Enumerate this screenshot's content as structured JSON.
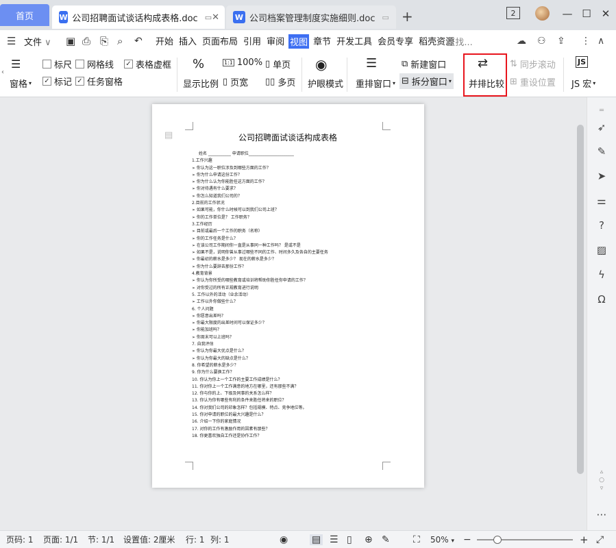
{
  "tabs": {
    "home": "首页",
    "active_doc": "公司招聘面试谈话构成表格.doc",
    "inactive_doc": "公司档案管理制度实施细则.doc",
    "new_tab": "+",
    "window_count": "2"
  },
  "menu": {
    "file": "文件",
    "search": "查找...",
    "items": [
      "开始",
      "插入",
      "页面布局",
      "引用",
      "审阅",
      "视图",
      "章节",
      "开发工具",
      "会员专享",
      "稻壳资源"
    ],
    "selected": "视图"
  },
  "ribbon": {
    "nav_pane": "窗格",
    "ruler": "标尺",
    "gridlines": "网格线",
    "table_gridlines": "表格虚框",
    "marks": "标记",
    "task_pane": "任务窗格",
    "display_ratio": "显示比例",
    "zoom_100": "100%",
    "page_width": "页宽",
    "single_page": "单页",
    "multi_page": "多页",
    "eye_mode": "护眼模式",
    "rearrange_window": "重排窗口",
    "new_window": "新建窗口",
    "split_window": "拆分窗口",
    "side_by_side": "并排比较",
    "sync_scroll": "同步滚动",
    "reset_position": "重设位置",
    "js_macro": "JS 宏"
  },
  "document": {
    "title": "公司招聘面试谈话构成表格",
    "lines": [
      "姓名 ___________          申请职位______________________",
      "1.工作兴趣",
      "➢   你认为这一职位涉及到哪些方面的工作？",
      "➢   你为什么申请这份工作？",
      "➢   你为什么认为你能胜任这方面的工作？",
      "➢   你对待遇有什么要求？",
      "➢   你怎么知道我们公司的？",
      "2.目前的工作状况",
      "➢   如果可能，你什么时候可以到我们公司上班？",
      "➢   你的工作单位是？   工作职务？",
      "3.工作经历",
      "➢   目前或最后一个工作的职务（名称）",
      "➢   你的工作任务是什么？",
      "➢   在该公司工作期间你一直是从事同一种工作吗？ 是或不是",
      "➢   如果不是，说明你曾从事过哪些不同的工作、时间多久及各自的主要任务",
      "➢   你最初的薪水是多少？ 现在的薪水是多少？",
      "➢   你为什么要辞去那份工作？",
      "4.教育背景",
      "➢   你认为你所受的哪些教育或培训将帮助你胜任你申请的工作？",
      "➢   对你受过的所有正规教育进行说明",
      "5. 工作以外的活动（业余活动）",
      "➢   工作以外你做些什么？",
      "6. 个人问题",
      "➢   你愿意出差吗？",
      "➢   你最大限度的出差时间可以保证多少？",
      "➢   你能加班吗？",
      "➢   你周末可以上班吗？",
      "7. 自我评估",
      "➢   你认为你最大优点是什么？",
      "➢   你认为你最大的缺点是什么？",
      "8. 你希望的薪水是多少？",
      "9. 你为什么要换工作？",
      "10. 你认为你上一个工作的主要工作成绩是什么？",
      "11. 你对你上一个工作满意的地方在哪里，还有那些不满？",
      "12. 你与你的上、下级及同事的关系怎么样？",
      "13. 你认为你有哪些有利的条件来胜任将来的职位？",
      "14. 你对我们公司的印象怎样？包括规模、特点、竞争地位等。",
      "15. 你对申请的职位的最大兴趣是什么？",
      "16. 介绍一下你的家庭情况",
      "17. 对你的工作有激励作用的因素有那些？",
      "18. 你更喜欢独自工作还是协作工作？"
    ]
  },
  "status": {
    "page_num": "页码: 1",
    "pages": "页面: 1/1",
    "section": "节: 1/1",
    "setting": "设置值: 2厘米",
    "row": "行: 1",
    "col": "列: 1",
    "zoom": "50%"
  },
  "colors": {
    "accent": "#3e6ff2",
    "highlight_box": "#e8141c"
  }
}
